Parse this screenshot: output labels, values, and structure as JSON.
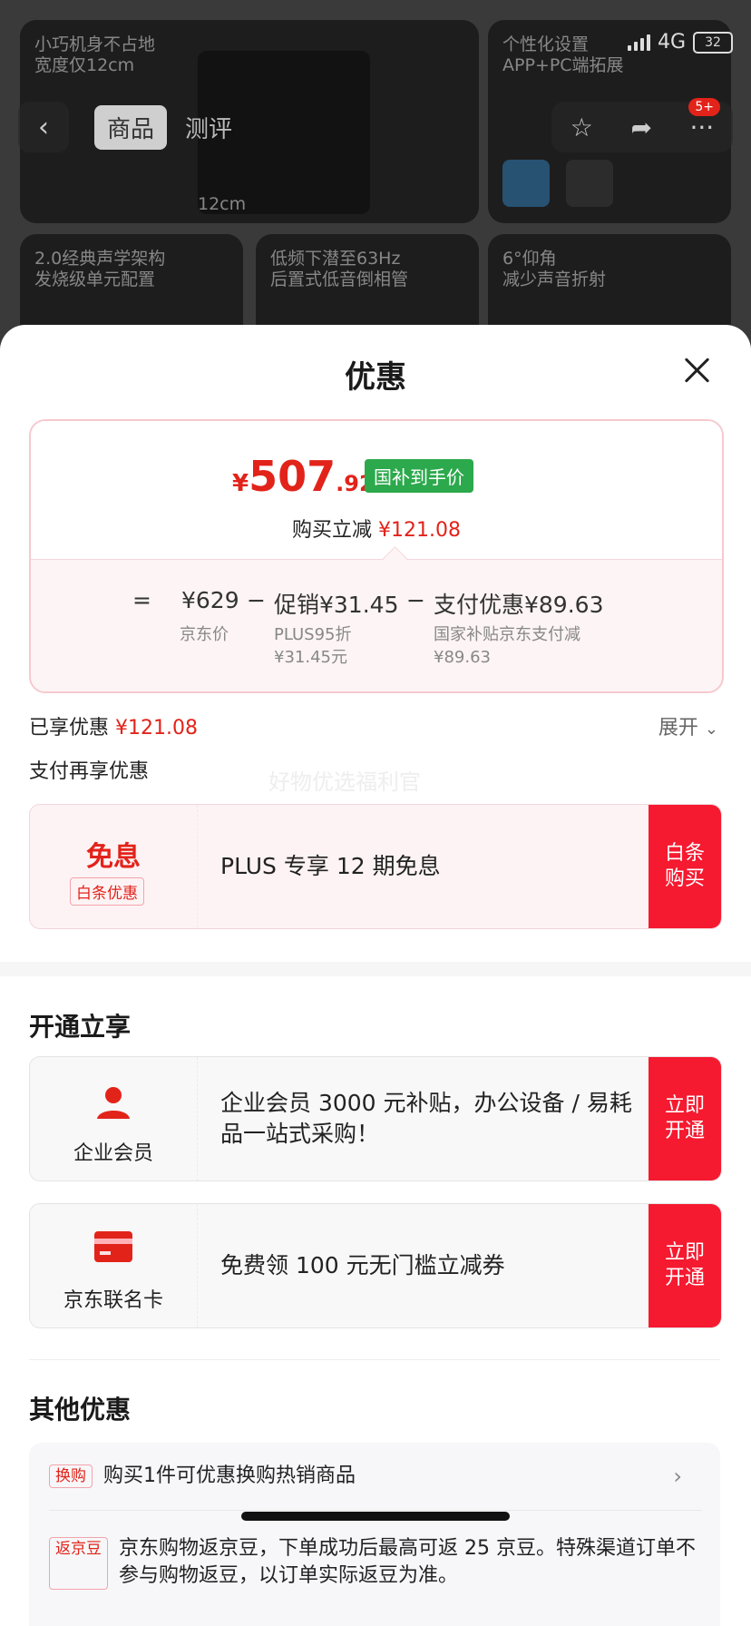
{
  "status": {
    "network": "4G",
    "battery": "32"
  },
  "background": {
    "tiles": [
      {
        "text1": "小巧机身不占地",
        "text2": "宽度仅12cm"
      },
      {
        "text1": "个性化设置",
        "text2": "APP+PC端拓展"
      },
      {
        "text1": "2.0经典声学架构",
        "text2": "发烧级单元配置"
      },
      {
        "text1": "低频下潜至63Hz",
        "text2": "后置式低音倒相管"
      },
      {
        "text1": "6°仰角",
        "text2": "减少声音折射"
      }
    ],
    "tile1_dim": "12cm",
    "tabs": {
      "product": "商品",
      "review": "测评"
    },
    "cart_badge": "5+"
  },
  "sheet": {
    "title": "优惠",
    "price": {
      "currency": "¥",
      "integer": "507",
      "decimal": ".92",
      "tag": "国补到手价"
    },
    "reduce": {
      "label": "购买立减",
      "amount": "¥121.08"
    },
    "breakdown": {
      "eq": "=",
      "jd_price": "¥629",
      "jd_price_label": "京东价",
      "minus": "−",
      "promo": "促销¥31.45",
      "promo_sub1": "PLUS95折",
      "promo_sub2": "¥31.45元",
      "pay": "支付优惠¥89.63",
      "pay_sub1": "国家补贴京东支付减",
      "pay_sub2": "¥89.63"
    },
    "enjoyed": {
      "label": "已享优惠",
      "amount": "¥121.08"
    },
    "expand": "展开",
    "pay_again": "支付再享优惠",
    "watermark": "好物优选福利官",
    "baitiao_card": {
      "title": "免息",
      "tag": "白条优惠",
      "text": "PLUS 专享 12 期免息",
      "cta": "白条购买"
    },
    "open_section": "开通立享",
    "enterprise_card": {
      "label": "企业会员",
      "text": "企业会员 3000 元补贴，办公设备 / 易耗品一站式采购！",
      "cta": "立即开通"
    },
    "jdcard": {
      "label": "京东联名卡",
      "text": "免费领 100 元无门槛立减券",
      "cta": "立即开通"
    },
    "other_section": "其他优惠",
    "others": [
      {
        "tag": "换购",
        "text": "购买1件可优惠换购热销商品"
      },
      {
        "tag": "返京豆",
        "text": "京东购物返京豆，下单成功后最高可返 25 京豆。特殊渠道订单不参与购物返豆，以订单实际返豆为准。"
      }
    ]
  },
  "colors": {
    "accent": "#e2231a",
    "cta": "#f51a30",
    "green": "#2ca94c"
  }
}
